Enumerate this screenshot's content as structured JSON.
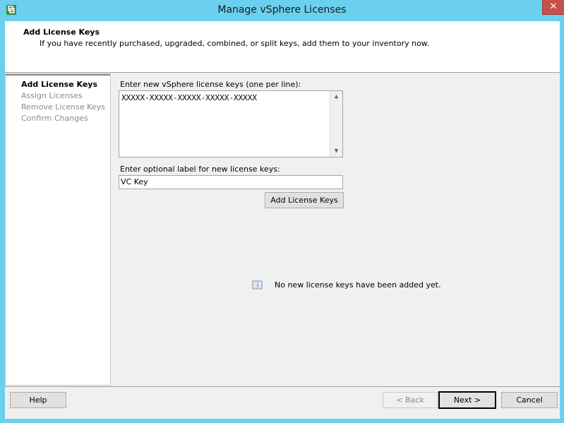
{
  "window": {
    "title": "Manage vSphere Licenses",
    "close_label": "✕"
  },
  "header": {
    "title": "Add License Keys",
    "description": "If you have recently purchased, upgraded, combined, or split keys, add them to your inventory now."
  },
  "steps": [
    {
      "label": "Add License Keys",
      "active": true
    },
    {
      "label": "Assign Licenses",
      "active": false
    },
    {
      "label": "Remove License Keys",
      "active": false
    },
    {
      "label": "Confirm Changes",
      "active": false
    }
  ],
  "form": {
    "keys_label": "Enter new vSphere license keys (one per line):",
    "keys_value": "XXXXX-XXXXX-XXXXX-XXXXX-XXXXX",
    "label_label": "Enter optional label for new license keys:",
    "label_value": "VC Key",
    "add_button": "Add License Keys"
  },
  "status": {
    "message": "No new license keys have been added yet."
  },
  "footer": {
    "help": "Help",
    "back": "< Back",
    "next": "Next >",
    "cancel": "Cancel"
  },
  "colors": {
    "titlebar": "#6ad0ee",
    "close": "#c7504a"
  }
}
